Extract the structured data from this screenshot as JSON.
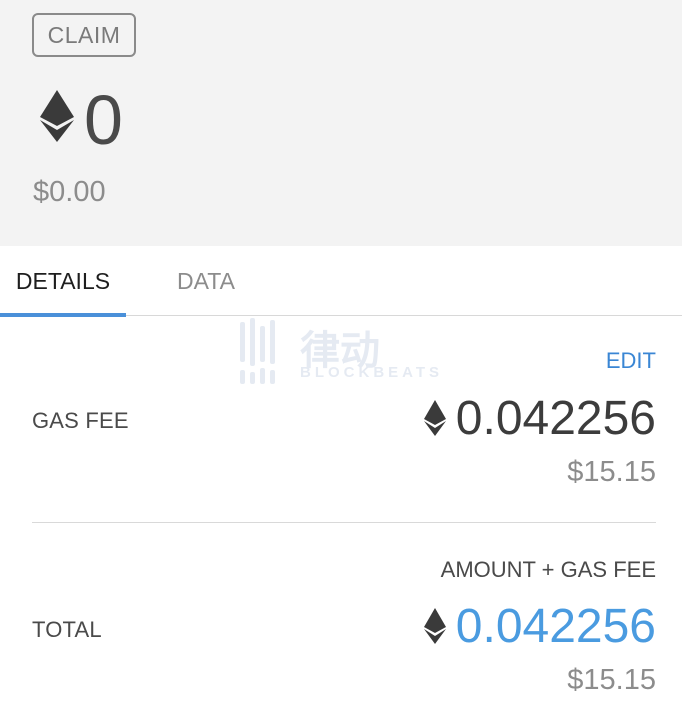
{
  "header": {
    "badge": "CLAIM",
    "amount": "0",
    "fiat": "$0.00"
  },
  "tabs": [
    {
      "label": "DETAILS",
      "active": true
    },
    {
      "label": "DATA",
      "active": false
    }
  ],
  "watermark": {
    "brand_cn": "律动",
    "brand_en": "BLOCKBEATS"
  },
  "details": {
    "edit_label": "EDIT",
    "gas_fee": {
      "label": "GAS FEE",
      "amount": "0.042256",
      "fiat": "$15.15"
    },
    "total": {
      "caption": "AMOUNT + GAS FEE",
      "label": "TOTAL",
      "amount": "0.042256",
      "fiat": "$15.15"
    }
  },
  "icons": {
    "currency": "ethereum-icon"
  },
  "colors": {
    "accent": "#4a90d9",
    "total_amount": "#4a9be0",
    "header_bg": "#f3f3f3"
  }
}
